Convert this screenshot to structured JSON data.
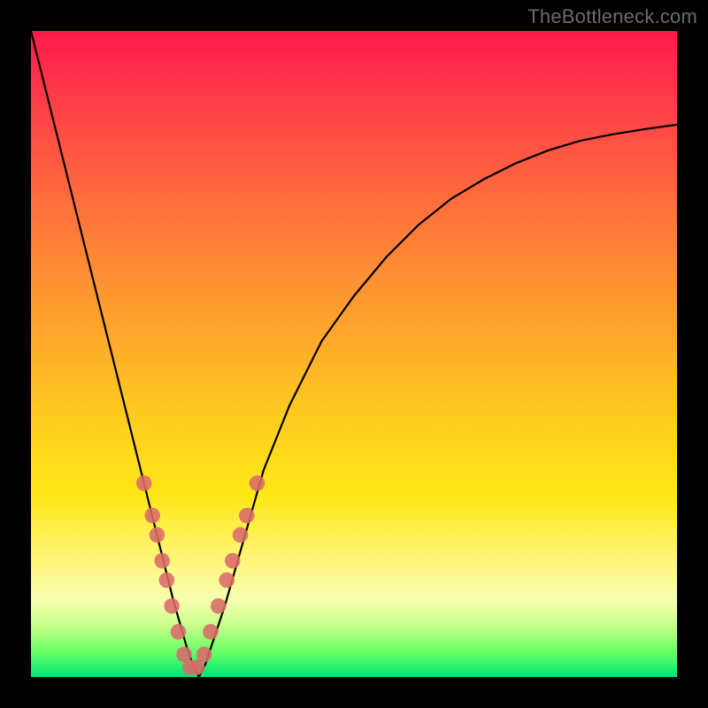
{
  "watermark": "TheBottleneck.com",
  "chart_data": {
    "type": "line",
    "title": "",
    "xlabel": "",
    "ylabel": "",
    "xlim": [
      0,
      100
    ],
    "ylim": [
      0,
      100
    ],
    "grid": false,
    "legend": false,
    "background_gradient": {
      "top": "#ff1a4d",
      "upper_mid": "#ff8a35",
      "mid": "#ffd21e",
      "lower_mid": "#fff67a",
      "bottom": "#00e676"
    },
    "series": [
      {
        "name": "bottleneck-curve",
        "color": "#000000",
        "x": [
          0,
          2,
          4,
          6,
          8,
          10,
          12,
          14,
          16,
          18,
          20,
          22,
          24,
          25,
          26,
          27,
          28,
          30,
          32,
          34,
          36,
          40,
          45,
          50,
          55,
          60,
          65,
          70,
          75,
          80,
          85,
          90,
          95,
          100
        ],
        "y": [
          100,
          92,
          84,
          76,
          68,
          60,
          52,
          44,
          36,
          28,
          20,
          12,
          5,
          2,
          0,
          2,
          5,
          11,
          18,
          25,
          32,
          42,
          52,
          59,
          65,
          70,
          74,
          77,
          79.5,
          81.5,
          83,
          84,
          84.8,
          85.5
        ]
      }
    ],
    "highlight_points": {
      "name": "beads",
      "color": "#d96a6a",
      "radius_pct": 1.2,
      "points": [
        {
          "x": 17.5,
          "y": 30
        },
        {
          "x": 18.8,
          "y": 25
        },
        {
          "x": 19.5,
          "y": 22
        },
        {
          "x": 20.3,
          "y": 18
        },
        {
          "x": 21.0,
          "y": 15
        },
        {
          "x": 21.8,
          "y": 11
        },
        {
          "x": 22.8,
          "y": 7
        },
        {
          "x": 23.7,
          "y": 3.5
        },
        {
          "x": 24.6,
          "y": 1.5
        },
        {
          "x": 25.7,
          "y": 1.5
        },
        {
          "x": 26.8,
          "y": 3.5
        },
        {
          "x": 27.8,
          "y": 7
        },
        {
          "x": 29.0,
          "y": 11
        },
        {
          "x": 30.3,
          "y": 15
        },
        {
          "x": 31.2,
          "y": 18
        },
        {
          "x": 32.4,
          "y": 22
        },
        {
          "x": 33.4,
          "y": 25
        },
        {
          "x": 35.0,
          "y": 30
        }
      ]
    }
  }
}
